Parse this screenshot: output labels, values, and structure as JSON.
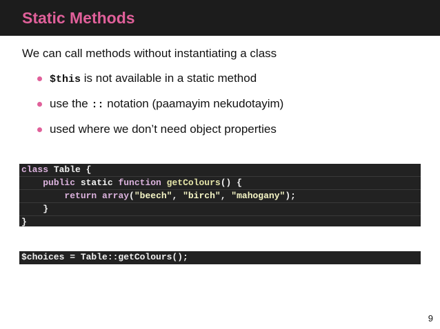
{
  "slide": {
    "title": "Static Methods",
    "intro": "We can call methods without instantiating a class",
    "bullets": [
      {
        "code": "$this",
        "text": " is not available in a static method"
      },
      {
        "pre": "use the ",
        "code": "::",
        "text": " notation (paamayim nekudotayim)"
      },
      {
        "text": "used where we don’t need object properties"
      }
    ],
    "page_number": "9",
    "accent_color": "#e0609a",
    "code_background": "#222222"
  },
  "code": {
    "l1": {
      "kw": "class",
      "name": " Table {"
    },
    "l2": {
      "indent": "    ",
      "kw1": "public",
      "mid": " static ",
      "kw2": "function",
      "fn": " getColours",
      "rest": "() {"
    },
    "l3": {
      "indent": "        ",
      "kw1": "return",
      "fn": " array",
      "p1": "(",
      "s1": "\"beech\"",
      "c1": ", ",
      "s2": "\"birch\"",
      "c2": ", ",
      "s3": "\"mahogany\"",
      "end": ");"
    },
    "l4": {
      "text": "    }"
    },
    "l5": {
      "text": "}"
    },
    "choices": "$choices = Table::getColours();"
  }
}
